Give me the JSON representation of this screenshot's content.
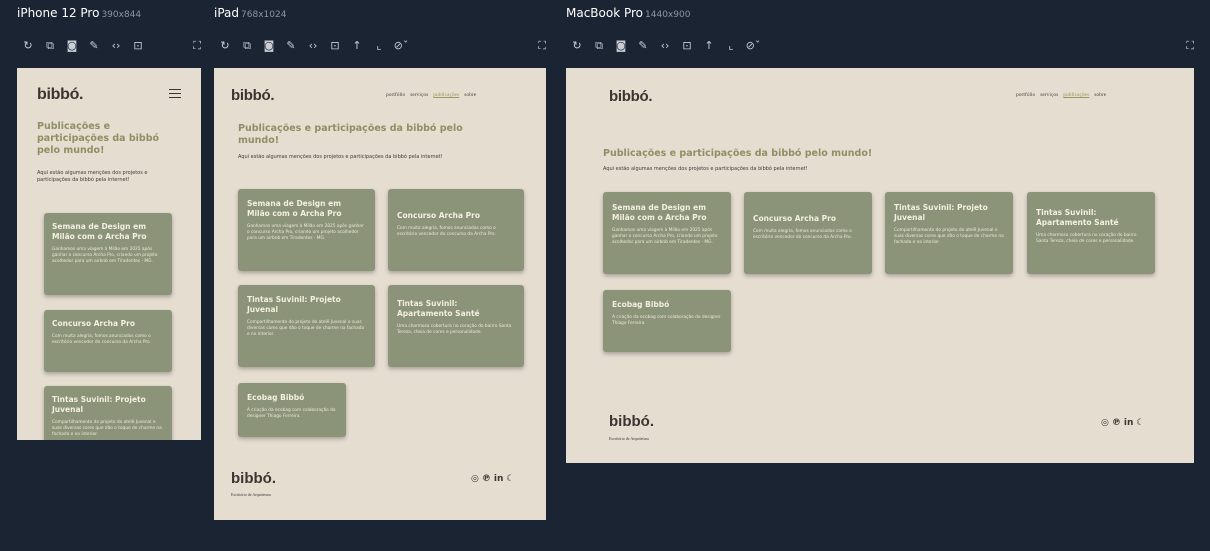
{
  "devices": {
    "iphone": {
      "name": "iPhone 12 Pro",
      "dims": "390x844"
    },
    "ipad": {
      "name": "iPad",
      "dims": "768x1024"
    },
    "macbook": {
      "name": "MacBook Pro",
      "dims": "1440x900"
    }
  },
  "toolbar_icons": [
    "refresh-icon",
    "rotate-icon",
    "screenshot-icon",
    "pen-icon",
    "code-icon",
    "layout-icon",
    "arrow-up-icon",
    "crop-icon",
    "eye-off-icon",
    "expand-icon"
  ],
  "site": {
    "logo": "bibbó.",
    "nav": [
      "portfólio",
      "serviços",
      "publicações",
      "sobre"
    ],
    "page_title": "Publicações e participações da bibbó pelo mundo!",
    "page_subtitle": "Aqui estão algumas menções dos projetos e participações da bibbó pela internet!",
    "cards": [
      {
        "title": "Semana de Design em Milão com o Archa Pro",
        "desc": "Ganhamos uma viagem à Milão em 2025 após ganhar o concurso Archa Pro, criando um projeto acolhedor para um airbnb em Tiradentes - MG."
      },
      {
        "title": "Concurso Archa Pro",
        "desc": "Com muita alegria, fomos anunciados como o escritório vencedor do concurso da Archa Pro."
      },
      {
        "title": "Tintas Suvinil: Projeto Juvenal",
        "desc": "Compartilhamento do projeto do atelê Juvenal e suas diversas cores que dão o toque de charme na fachada e no interior."
      },
      {
        "title": "Tintas Suvinil: Apartamento Santé",
        "desc": "Uma charmosa cobertura no coração do bairro Santa Tereza, cheia de cores e personalidade."
      },
      {
        "title": "Ecobag Bibbó",
        "desc": "A criação da ecobag com colaboração do designer Thiago Ferreira."
      }
    ],
    "footer": {
      "logo": "bibbó.",
      "tagline": "Escritório de Arquitetura",
      "social": [
        "instagram-icon",
        "pinterest-icon",
        "linkedin-icon",
        "moon-icon"
      ],
      "linkedin_text": "in"
    }
  },
  "colors": {
    "background": "#1b2432",
    "page": "#e6ddd1",
    "card": "#8b9478",
    "title_accent": "#8d8f64",
    "dark_text": "#3b3531"
  }
}
